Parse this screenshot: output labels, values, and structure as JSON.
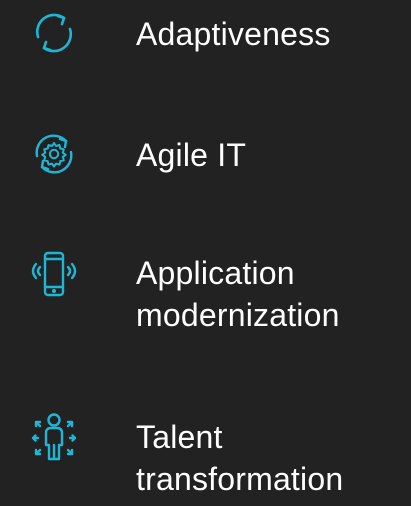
{
  "accent_color": "#1FB6D6",
  "background_color": "#222222",
  "text_color": "#FFFFFF",
  "items": [
    {
      "label": "Adaptiveness",
      "icon": "circular-arrows-icon"
    },
    {
      "label": "Agile IT",
      "icon": "gear-cycle-icon"
    },
    {
      "label": "Application\nmodernization",
      "icon": "mobile-phone-icon"
    },
    {
      "label": "Talent\ntransformation",
      "icon": "person-expand-icon"
    }
  ]
}
